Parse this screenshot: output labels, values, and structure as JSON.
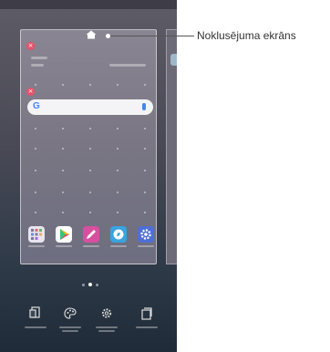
{
  "callout": {
    "label": "Noklusējuma ekrāns"
  },
  "search_bar": {
    "logo": "G"
  },
  "colors": {
    "accent_remove": "#e8506a",
    "callout_line": "#555555"
  },
  "dock_apps": [
    {
      "icon": "apps-folder-icon",
      "color": "#e9e4ef"
    },
    {
      "icon": "play-store-icon",
      "color": "#ffffff"
    },
    {
      "icon": "qnote-pencil-icon",
      "color": "#d84f9f"
    },
    {
      "icon": "browser-icon",
      "color": "#3aa3e0"
    },
    {
      "icon": "settings-gear-icon",
      "color": "#4f6fd6"
    }
  ],
  "bottom_bar": [
    {
      "icon": "widgets-icon"
    },
    {
      "icon": "wallpaper-theme-icon"
    },
    {
      "icon": "home-settings-icon"
    },
    {
      "icon": "apps-icon"
    }
  ]
}
